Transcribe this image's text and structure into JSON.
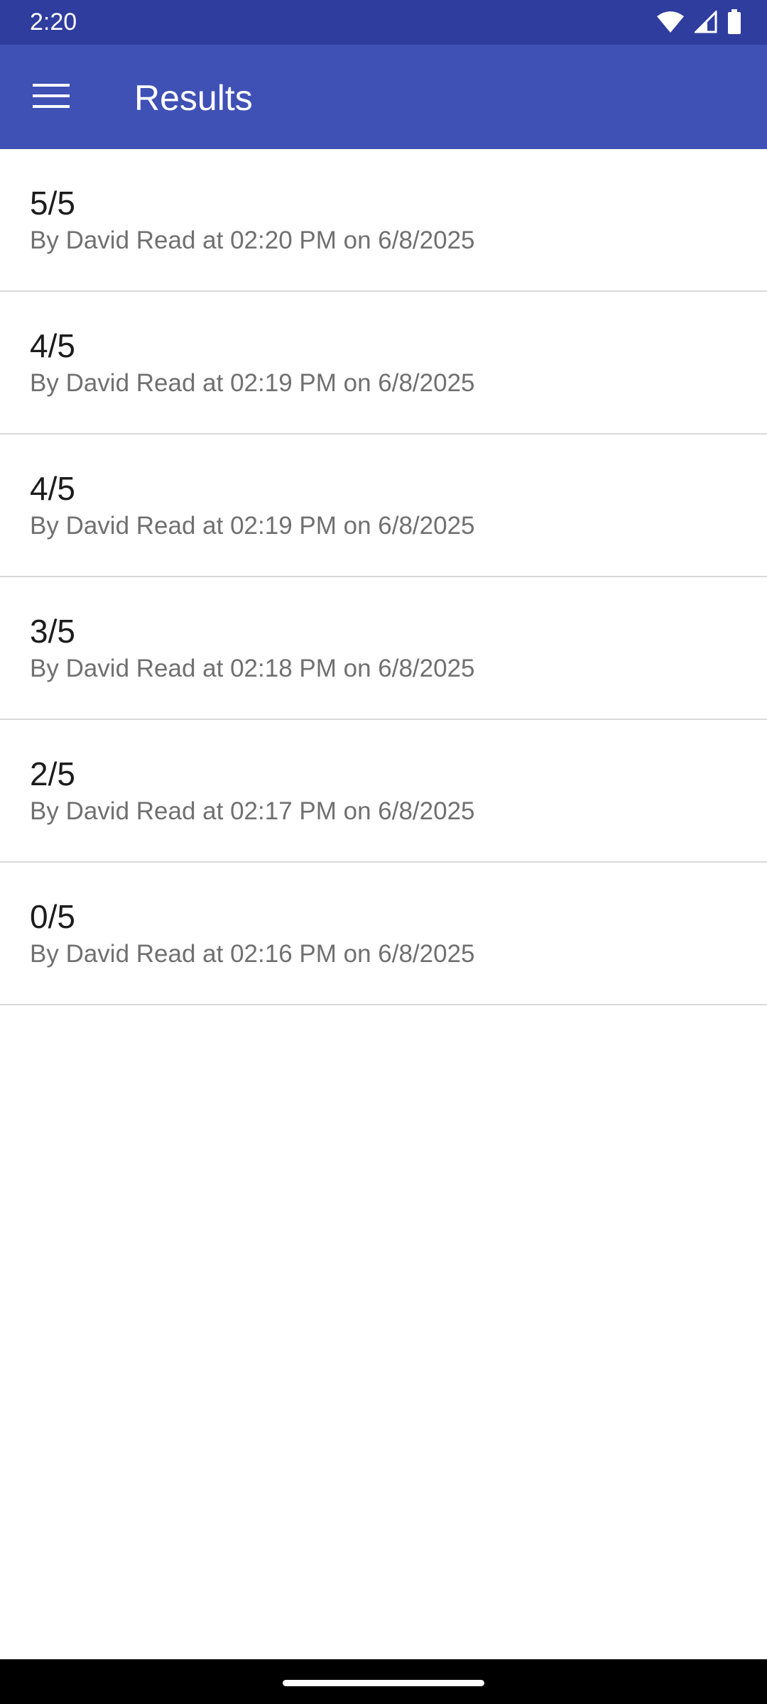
{
  "status_bar": {
    "time": "2:20",
    "icons": [
      "wifi-icon",
      "cellular-signal-icon",
      "battery-icon"
    ]
  },
  "app_bar": {
    "menu_icon": "hamburger-menu-icon",
    "title": "Results",
    "background_color": "#3f51b5",
    "status_bar_color": "#2f3d9e"
  },
  "results": [
    {
      "score": "5/5",
      "meta": "By David Read at 02:20 PM on 6/8/2025"
    },
    {
      "score": "4/5",
      "meta": "By David Read at 02:19 PM on 6/8/2025"
    },
    {
      "score": "4/5",
      "meta": "By David Read at 02:19 PM on 6/8/2025"
    },
    {
      "score": "3/5",
      "meta": "By David Read at 02:18 PM on 6/8/2025"
    },
    {
      "score": "2/5",
      "meta": "By David Read at 02:17 PM on 6/8/2025"
    },
    {
      "score": "0/5",
      "meta": "By David Read at 02:16 PM on 6/8/2025"
    }
  ],
  "navigation_bar": {
    "handle": "home-gesture-handle"
  }
}
